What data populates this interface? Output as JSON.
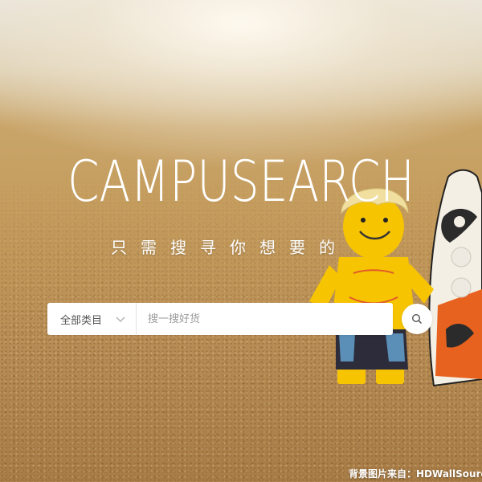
{
  "logo": {
    "part1": "CAMPU",
    "part2": "SEARCH"
  },
  "slogan": "只需搜寻你想要的",
  "search": {
    "category_label": "全部类目",
    "placeholder": "搜一搜好货",
    "value": ""
  },
  "footer": {
    "credit": "背景图片来自：HDWallSource"
  },
  "icons": {
    "search_button": "search-icon",
    "category_dropdown": "chevron-down-icon",
    "logo": "campusearch-logo"
  },
  "colors": {
    "logo_text": "#ffffff",
    "search_box": "#ffffff",
    "placeholder": "#9a9a9a"
  }
}
